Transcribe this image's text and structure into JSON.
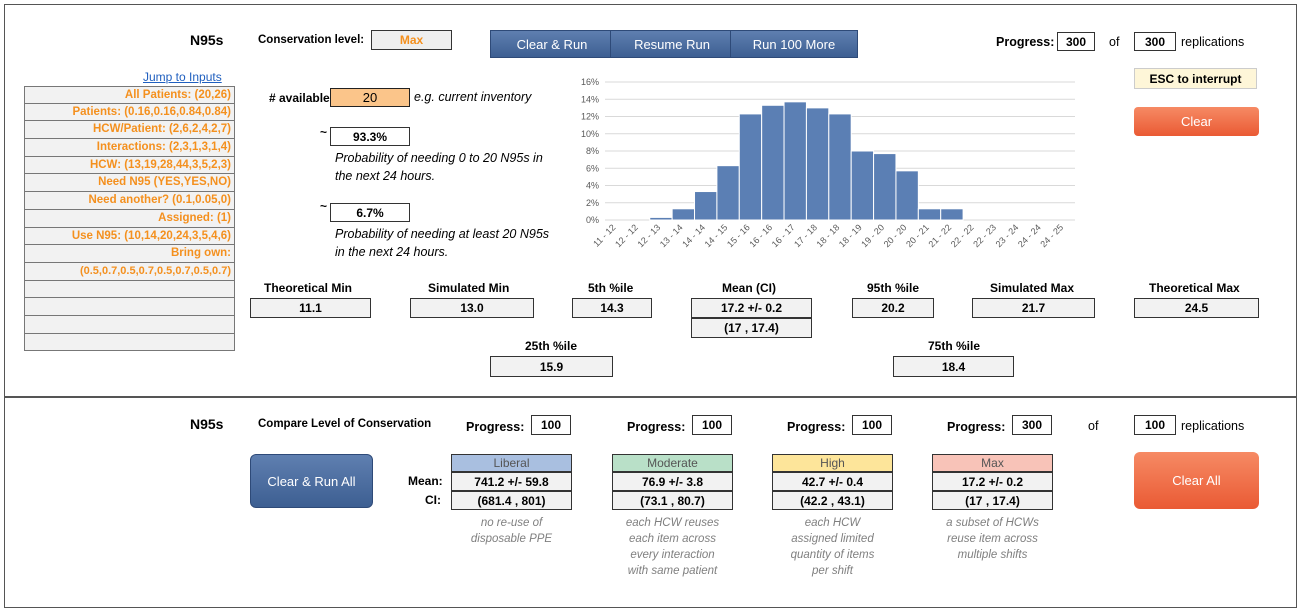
{
  "top": {
    "title": "N95s",
    "conservation_label": "Conservation level:",
    "conservation_value": "Max",
    "buttons": {
      "clear_run": "Clear & Run",
      "resume_run": "Resume Run",
      "run_more": "Run 100 More"
    },
    "progress_label": "Progress:",
    "progress_value": "300",
    "of_label": "of",
    "total_value": "300",
    "replications_label": "replications",
    "esc_hint": "ESC to interrupt",
    "clear_button": "Clear",
    "jump_link": "Jump to Inputs",
    "sidebar": [
      "All Patients: (20,26)",
      "Patients: (0.16,0.16,0.84,0.84)",
      "HCW/Patient: (2,6,2,4,2,7)",
      "Interactions: (2,3,1,3,1,4)",
      "HCW: (13,19,28,44,3,5,2,3)",
      "Need N95 (YES,YES,NO)",
      "Need another? (0.1,0.05,0)",
      "Assigned: (1)",
      "Use N95: (10,14,20,24,3,5,4,6)",
      "Bring own:",
      "(0.5,0.7,0.5,0.7,0.5,0.7,0.5,0.7)",
      "",
      "",
      "",
      ""
    ],
    "available_label": "# available:",
    "available_value": "20",
    "available_hint": "e.g. current inventory",
    "tilde": "~",
    "prob1_value": "93.3%",
    "prob1_text_l1": "Probability of needing 0 to 20 N95s in",
    "prob1_text_l2": "the next 24 hours.",
    "prob2_value": "6.7%",
    "prob2_text_l1": "Probability of needing at least 20 N95s",
    "prob2_text_l2": "in the next 24 hours.",
    "stats": {
      "theo_min_label": "Theoretical Min",
      "theo_min": "11.1",
      "sim_min_label": "Simulated Min",
      "sim_min": "13.0",
      "p5_label": "5th %ile",
      "p5": "14.3",
      "mean_label": "Mean (CI)",
      "mean": "17.2 +/- 0.2",
      "ci": "(17 , 17.4)",
      "p95_label": "95th %ile",
      "p95": "20.2",
      "sim_max_label": "Simulated Max",
      "sim_max": "21.7",
      "theo_max_label": "Theoretical Max",
      "theo_max": "24.5",
      "p25_label": "25th %ile",
      "p25": "15.9",
      "p75_label": "75th %ile",
      "p75": "18.4"
    }
  },
  "bottom": {
    "title": "N95s",
    "compare_label": "Compare Level of Conservation",
    "progress_label": "Progress:",
    "of_label": "of",
    "total_value": "100",
    "replications_label": "replications",
    "clear_run_all": "Clear & Run All",
    "clear_all": "Clear All",
    "mean_label": "Mean:",
    "ci_label": "CI:",
    "levels": [
      {
        "name": "Liberal",
        "progress": "100",
        "mean": "741.2 +/- 59.8",
        "ci": "(681.4 , 801)",
        "desc": [
          "no re-use of",
          "disposable PPE"
        ],
        "color": "#a9bfe0"
      },
      {
        "name": "Moderate",
        "progress": "100",
        "mean": "76.9 +/- 3.8",
        "ci": "(73.1 , 80.7)",
        "desc": [
          "each HCW reuses",
          "each item across",
          "every interaction",
          "with same patient"
        ],
        "color": "#b9e0c8"
      },
      {
        "name": "High",
        "progress": "100",
        "mean": "42.7 +/- 0.4",
        "ci": "(42.2 , 43.1)",
        "desc": [
          "each HCW",
          "assigned limited",
          "quantity of items",
          "per shift"
        ],
        "color": "#fde59a"
      },
      {
        "name": "Max",
        "progress": "300",
        "mean": "17.2 +/- 0.2",
        "ci": "(17 , 17.4)",
        "desc": [
          "a subset of HCWs",
          "reuse item across",
          "multiple shifts"
        ],
        "color": "#f8c3b8"
      }
    ]
  },
  "colors": {
    "orange_text": "#f4901e",
    "bar": "#5b7fb4",
    "button_blue": "#4a6ca0",
    "button_orange": "#f26b45"
  },
  "chart_data": {
    "type": "bar",
    "categories": [
      "11 - 12",
      "12 - 12",
      "12 - 13",
      "13 - 14",
      "14 - 14",
      "14 - 15",
      "15 - 16",
      "16 - 16",
      "16 - 17",
      "17 - 18",
      "18 - 18",
      "18 - 19",
      "19 - 20",
      "20 - 20",
      "20 - 21",
      "21 - 22",
      "22 - 22",
      "22 - 23",
      "23 - 24",
      "24 - 24",
      "24 - 25"
    ],
    "values": [
      0,
      0,
      0.3,
      1.3,
      3.3,
      6.3,
      12.3,
      13.3,
      13.7,
      13.0,
      12.3,
      8.0,
      7.7,
      5.7,
      1.3,
      1.3,
      0,
      0,
      0,
      0,
      0
    ],
    "yticks": [
      "0%",
      "2%",
      "4%",
      "6%",
      "8%",
      "10%",
      "12%",
      "14%",
      "16%"
    ],
    "ylim": [
      0,
      16
    ]
  }
}
